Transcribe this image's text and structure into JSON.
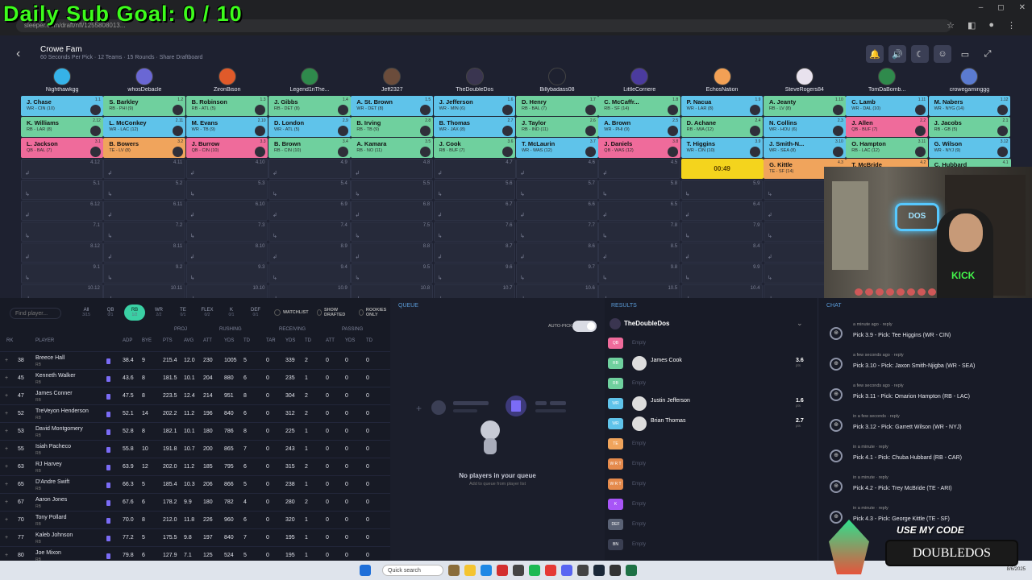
{
  "overlay": {
    "goal_label": "Daily Sub Goal:",
    "goal_value": "0 / 10"
  },
  "browser": {
    "url": "sleeper.com/draft/nfl/1255808013...",
    "win_min": "–",
    "win_max": "◻",
    "win_close": "✕"
  },
  "draft": {
    "title": "Crowe Fam",
    "subtitle": "60 Seconds Per Pick · 12 Teams · 15 Rounds · Share Draftboard",
    "timer": "00:49",
    "colors": {
      "WR": "#5fc3ea",
      "RB": "#6fd09e",
      "QB": "#ef6b9b",
      "TE": "#f0a45c",
      "timer": "#f4d41d"
    }
  },
  "teams": [
    {
      "name": "Nighthawkgg",
      "color": "#36b2e8"
    },
    {
      "name": "whosDebacle",
      "color": "#6a67d4"
    },
    {
      "name": "ZironBison",
      "color": "#e05a2a"
    },
    {
      "name": "Legend1nThe...",
      "color": "#2f8a4c"
    },
    {
      "name": "Jeff2327",
      "color": "#6b4c3b"
    },
    {
      "name": "TheDoubleDos",
      "color": "#3a3550"
    },
    {
      "name": "Billybadass08",
      "color": "#1e2130"
    },
    {
      "name": "LittleCorriere",
      "color": "#4b3b9e"
    },
    {
      "name": "EchosNation",
      "color": "#f2a055"
    },
    {
      "name": "SteveRogers84",
      "color": "#e8e2ee"
    },
    {
      "name": "TomDaBomb...",
      "color": "#2f8a4c"
    },
    {
      "name": "crowegaminggg",
      "color": "#5b7bd0"
    }
  ],
  "board": {
    "round1": [
      {
        "name": "J. Chase",
        "detail": "WR - CIN (10)",
        "pick": "1.1",
        "pos": "WR"
      },
      {
        "name": "S. Barkley",
        "detail": "RB - PHI (9)",
        "pick": "1.2",
        "pos": "RB"
      },
      {
        "name": "B. Robinson",
        "detail": "RB - ATL (5)",
        "pick": "1.3",
        "pos": "RB"
      },
      {
        "name": "J. Gibbs",
        "detail": "RB - DET (8)",
        "pick": "1.4",
        "pos": "RB"
      },
      {
        "name": "A. St. Brown",
        "detail": "WR - DET (8)",
        "pick": "1.5",
        "pos": "WR"
      },
      {
        "name": "J. Jefferson",
        "detail": "WR - MIN (6)",
        "pick": "1.6",
        "pos": "WR"
      },
      {
        "name": "D. Henry",
        "detail": "RB - BAL (7)",
        "pick": "1.7",
        "pos": "RB"
      },
      {
        "name": "C. McCaffr...",
        "detail": "RB - SF (14)",
        "pick": "1.8",
        "pos": "RB"
      },
      {
        "name": "P. Nacua",
        "detail": "WR - LAR (8)",
        "pick": "1.9",
        "pos": "WR"
      },
      {
        "name": "A. Jeanty",
        "detail": "RB - LV (8)",
        "pick": "1.10",
        "pos": "RB"
      },
      {
        "name": "C. Lamb",
        "detail": "WR - DAL (10)",
        "pick": "1.11",
        "pos": "WR"
      },
      {
        "name": "M. Nabers",
        "detail": "WR - NYG (14)",
        "pick": "1.12",
        "pos": "WR"
      }
    ],
    "round2": [
      {
        "name": "K. Williams",
        "detail": "RB - LAR (8)",
        "pick": "2.12",
        "pos": "RB"
      },
      {
        "name": "L. McConkey",
        "detail": "WR - LAC (12)",
        "pick": "2.11",
        "pos": "WR"
      },
      {
        "name": "M. Evans",
        "detail": "WR - TB (9)",
        "pick": "2.10",
        "pos": "WR"
      },
      {
        "name": "D. London",
        "detail": "WR - ATL (5)",
        "pick": "2.9",
        "pos": "WR"
      },
      {
        "name": "B. Irving",
        "detail": "RB - TB (9)",
        "pick": "2.8",
        "pos": "RB"
      },
      {
        "name": "B. Thomas",
        "detail": "WR - JAX (8)",
        "pick": "2.7",
        "pos": "WR"
      },
      {
        "name": "J. Taylor",
        "detail": "RB - IND (11)",
        "pick": "2.6",
        "pos": "RB"
      },
      {
        "name": "A. Brown",
        "detail": "WR - PHI (9)",
        "pick": "2.5",
        "pos": "WR"
      },
      {
        "name": "D. Achane",
        "detail": "RB - MIA (12)",
        "pick": "2.4",
        "pos": "RB"
      },
      {
        "name": "N. Collins",
        "detail": "WR - HOU (6)",
        "pick": "2.3",
        "pos": "WR"
      },
      {
        "name": "J. Allen",
        "detail": "QB - BUF (7)",
        "pick": "2.2",
        "pos": "QB"
      },
      {
        "name": "J. Jacobs",
        "detail": "RB - GB (5)",
        "pick": "2.1",
        "pos": "RB"
      }
    ],
    "round3": [
      {
        "name": "L. Jackson",
        "detail": "QB - BAL (7)",
        "pick": "3.1",
        "pos": "QB"
      },
      {
        "name": "B. Bowers",
        "detail": "TE - LV (8)",
        "pick": "3.2",
        "pos": "TE"
      },
      {
        "name": "J. Burrow",
        "detail": "QB - CIN (10)",
        "pick": "3.3",
        "pos": "QB"
      },
      {
        "name": "B. Brown",
        "detail": "RB - CIN (10)",
        "pick": "3.4",
        "pos": "RB"
      },
      {
        "name": "A. Kamara",
        "detail": "RB - NO (11)",
        "pick": "3.5",
        "pos": "RB"
      },
      {
        "name": "J. Cook",
        "detail": "RB - BUF (7)",
        "pick": "3.6",
        "pos": "RB"
      },
      {
        "name": "T. McLaurin",
        "detail": "WR - WAS (12)",
        "pick": "3.7",
        "pos": "WR"
      },
      {
        "name": "J. Daniels",
        "detail": "QB - WAS (12)",
        "pick": "3.8",
        "pos": "QB"
      },
      {
        "name": "T. Higgins",
        "detail": "WR - CIN (10)",
        "pick": "3.9",
        "pos": "WR"
      },
      {
        "name": "J. Smith-N...",
        "detail": "WR - SEA (8)",
        "pick": "3.10",
        "pos": "WR"
      },
      {
        "name": "O. Hampton",
        "detail": "RB - LAC (12)",
        "pick": "3.11",
        "pos": "RB"
      },
      {
        "name": "G. Wilson",
        "detail": "WR - NYJ (9)",
        "pick": "3.12",
        "pos": "WR"
      }
    ],
    "round4": [
      {
        "pick": "4.12"
      },
      {
        "pick": "4.11"
      },
      {
        "pick": "4.10"
      },
      {
        "pick": "4.9"
      },
      {
        "pick": "4.8"
      },
      {
        "pick": "4.7"
      },
      {
        "pick": "4.6"
      },
      {
        "pick": "4.5"
      },
      {
        "timer": "00:49"
      },
      {
        "name": "G. Kittle",
        "detail": "TE - SF (14)",
        "pick": "4.3",
        "pos": "TE"
      },
      {
        "name": "T. McBride",
        "detail": "TE - ARI (8)",
        "pick": "4.2",
        "pos": "TE"
      },
      {
        "name": "C. Hubbard",
        "detail": "RB - CAR (14)",
        "pick": "4.1",
        "pos": "RB"
      }
    ],
    "empty_rows": [
      [
        "5.1",
        "5.2",
        "5.3",
        "5.4",
        "5.5",
        "5.6",
        "5.7",
        "5.8",
        "5.9",
        "5.10",
        "5.11",
        "5.12"
      ],
      [
        "6.12",
        "6.11",
        "6.10",
        "6.9",
        "6.8",
        "6.7",
        "6.6",
        "6.5",
        "6.4",
        "6.3",
        "6.2",
        "6.1"
      ],
      [
        "7.1",
        "7.2",
        "7.3",
        "7.4",
        "7.5",
        "7.6",
        "7.7",
        "7.8",
        "7.9",
        "7.10",
        "7.11",
        "7.12"
      ],
      [
        "8.12",
        "8.11",
        "8.10",
        "8.9",
        "8.8",
        "8.7",
        "8.6",
        "8.5",
        "8.4",
        "8.3",
        "8.2",
        "8.1"
      ],
      [
        "9.1",
        "9.2",
        "9.3",
        "9.4",
        "9.5",
        "9.6",
        "9.7",
        "9.8",
        "9.9",
        "9.10",
        "9.11",
        "9.12"
      ],
      [
        "10.12",
        "10.11",
        "10.10",
        "10.9",
        "10.8",
        "10.7",
        "10.6",
        "10.5",
        "10.4",
        "10.3",
        "10.2",
        "10.1"
      ]
    ]
  },
  "webcam": {
    "neon_text": "DOS",
    "shirt_text": "KICK"
  },
  "player_list": {
    "search_placeholder": "Find player...",
    "positions": [
      {
        "label": "All",
        "count": "3/15"
      },
      {
        "label": "QB",
        "count": "0/1"
      },
      {
        "label": "RB",
        "count": "1/2"
      },
      {
        "label": "WR",
        "count": "2/2"
      },
      {
        "label": "TE",
        "count": "0/1"
      },
      {
        "label": "FLEX",
        "count": "0/2"
      },
      {
        "label": "K",
        "count": "0/1"
      },
      {
        "label": "DEF",
        "count": "0/1"
      }
    ],
    "toggles": [
      "WATCHLIST",
      "SHOW DRAFTED",
      "ROOKIES ONLY"
    ],
    "groups": {
      "proj": "PROJ",
      "rushing": "RUSHING",
      "receiving": "RECEIVING",
      "passing": "PASSING"
    },
    "columns": [
      "RK",
      "PLAYER",
      "ADP",
      "BYE",
      "PTS",
      "AVG",
      "ATT",
      "YDS",
      "TD",
      "TAR",
      "YDS",
      "TD",
      "ATT",
      "YDS",
      "TD"
    ],
    "rows": [
      {
        "rk": "38",
        "name": "Breece Hall",
        "team": "RB",
        "adp": "38.4",
        "bye": "9",
        "pts": "215.4",
        "avg": "12.0",
        "ratt": "230",
        "ryds": "1005",
        "rtd": "5",
        "tar": "0",
        "recyds": "339",
        "rectd": "2",
        "patt": "0",
        "pyds": "0",
        "ptd": "0"
      },
      {
        "rk": "45",
        "name": "Kenneth Walker",
        "team": "RB",
        "adp": "43.6",
        "bye": "8",
        "pts": "181.5",
        "avg": "10.1",
        "ratt": "204",
        "ryds": "880",
        "rtd": "6",
        "tar": "0",
        "recyds": "235",
        "rectd": "1",
        "patt": "0",
        "pyds": "0",
        "ptd": "0"
      },
      {
        "rk": "47",
        "name": "James Conner",
        "team": "RB",
        "adp": "47.5",
        "bye": "8",
        "pts": "223.5",
        "avg": "12.4",
        "ratt": "214",
        "ryds": "951",
        "rtd": "8",
        "tar": "0",
        "recyds": "304",
        "rectd": "2",
        "patt": "0",
        "pyds": "0",
        "ptd": "0"
      },
      {
        "rk": "52",
        "name": "TreVeyon Henderson",
        "team": "RB",
        "adp": "52.1",
        "bye": "14",
        "pts": "202.2",
        "avg": "11.2",
        "ratt": "196",
        "ryds": "840",
        "rtd": "6",
        "tar": "0",
        "recyds": "312",
        "rectd": "2",
        "patt": "0",
        "pyds": "0",
        "ptd": "0"
      },
      {
        "rk": "53",
        "name": "David Montgomery",
        "team": "RB",
        "adp": "52.8",
        "bye": "8",
        "pts": "182.1",
        "avg": "10.1",
        "ratt": "180",
        "ryds": "786",
        "rtd": "8",
        "tar": "0",
        "recyds": "225",
        "rectd": "1",
        "patt": "0",
        "pyds": "0",
        "ptd": "0"
      },
      {
        "rk": "55",
        "name": "Isiah Pacheco",
        "team": "RB",
        "adp": "55.8",
        "bye": "10",
        "pts": "191.8",
        "avg": "10.7",
        "ratt": "200",
        "ryds": "865",
        "rtd": "7",
        "tar": "0",
        "recyds": "243",
        "rectd": "1",
        "patt": "0",
        "pyds": "0",
        "ptd": "0"
      },
      {
        "rk": "63",
        "name": "RJ Harvey",
        "team": "RB",
        "adp": "63.9",
        "bye": "12",
        "pts": "202.0",
        "avg": "11.2",
        "ratt": "185",
        "ryds": "795",
        "rtd": "6",
        "tar": "0",
        "recyds": "315",
        "rectd": "2",
        "patt": "0",
        "pyds": "0",
        "ptd": "0"
      },
      {
        "rk": "65",
        "name": "D'Andre Swift",
        "team": "RB",
        "adp": "66.3",
        "bye": "5",
        "pts": "185.4",
        "avg": "10.3",
        "ratt": "206",
        "ryds": "866",
        "rtd": "5",
        "tar": "0",
        "recyds": "238",
        "rectd": "1",
        "patt": "0",
        "pyds": "0",
        "ptd": "0"
      },
      {
        "rk": "67",
        "name": "Aaron Jones",
        "team": "RB",
        "adp": "67.6",
        "bye": "6",
        "pts": "178.2",
        "avg": "9.9",
        "ratt": "180",
        "ryds": "782",
        "rtd": "4",
        "tar": "0",
        "recyds": "280",
        "rectd": "2",
        "patt": "0",
        "pyds": "0",
        "ptd": "0"
      },
      {
        "rk": "70",
        "name": "Tony Pollard",
        "team": "RB",
        "adp": "70.0",
        "bye": "8",
        "pts": "212.0",
        "avg": "11.8",
        "ratt": "226",
        "ryds": "960",
        "rtd": "6",
        "tar": "0",
        "recyds": "320",
        "rectd": "1",
        "patt": "0",
        "pyds": "0",
        "ptd": "0"
      },
      {
        "rk": "77",
        "name": "Kaleb Johnson",
        "team": "RB",
        "adp": "77.2",
        "bye": "5",
        "pts": "175.5",
        "avg": "9.8",
        "ratt": "197",
        "ryds": "840",
        "rtd": "7",
        "tar": "0",
        "recyds": "195",
        "rectd": "1",
        "patt": "0",
        "pyds": "0",
        "ptd": "0"
      },
      {
        "rk": "80",
        "name": "Joe Mixon",
        "team": "RB",
        "adp": "79.8",
        "bye": "6",
        "pts": "127.9",
        "avg": "7.1",
        "ratt": "125",
        "ryds": "524",
        "rtd": "5",
        "tar": "0",
        "recyds": "195",
        "rectd": "1",
        "patt": "0",
        "pyds": "0",
        "ptd": "0"
      }
    ]
  },
  "queue": {
    "label": "QUEUE",
    "autopick": "AUTO-PICK",
    "empty_title": "No players in your queue",
    "empty_sub": "Add to queue from player list"
  },
  "results": {
    "label": "RESULTS",
    "team": "TheDoubleDos",
    "rows": [
      {
        "pos": "QB",
        "color": "#ef6b9b",
        "empty": "Empty"
      },
      {
        "pos": "RB",
        "color": "#6fd09e",
        "name": "James Cook",
        "pts": "3.6",
        "ptslbl": "pts"
      },
      {
        "pos": "RB",
        "color": "#6fd09e",
        "empty": "Empty"
      },
      {
        "pos": "WR",
        "color": "#5fc3ea",
        "name": "Justin Jefferson",
        "pts": "1.6",
        "ptslbl": "pts"
      },
      {
        "pos": "WR",
        "color": "#5fc3ea",
        "name": "Brian Thomas",
        "pts": "2.7",
        "ptslbl": "pts"
      },
      {
        "pos": "TE",
        "color": "#f0a45c",
        "empty": "Empty"
      },
      {
        "pos": "W R T",
        "color": "#e58a4c",
        "empty": "Empty"
      },
      {
        "pos": "W R T",
        "color": "#e58a4c",
        "empty": "Empty"
      },
      {
        "pos": "K",
        "color": "#a855f7",
        "empty": "Empty"
      },
      {
        "pos": "DEF",
        "color": "#5a6275",
        "empty": "Empty"
      },
      {
        "pos": "BN",
        "color": "#3a3f52",
        "empty": "Empty"
      }
    ]
  },
  "chat": {
    "label": "CHAT",
    "messages": [
      {
        "time": "a minute ago · reply",
        "text": "Pick 3.9 - Pick: Tee Higgins (WR - CIN)"
      },
      {
        "time": "a few seconds ago · reply",
        "text": "Pick 3.10 - Pick: Jaxon Smith-Njigba (WR - SEA)"
      },
      {
        "time": "a few seconds ago · reply",
        "text": "Pick 3.11 - Pick: Omarion Hampton (RB - LAC)"
      },
      {
        "time": "in a few seconds · reply",
        "text": "Pick 3.12 - Pick: Garrett Wilson (WR - NYJ)"
      },
      {
        "time": "in a minute · reply",
        "text": "Pick 4.1 - Pick: Chuba Hubbard (RB - CAR)"
      },
      {
        "time": "in a minute · reply",
        "text": "Pick 4.2 - Pick: Trey McBride (TE - ARI)"
      },
      {
        "time": "in a minute · reply",
        "text": "Pick 4.3 - Pick: George Kittle (TE - SF)"
      }
    ]
  },
  "promo": {
    "label": "USE MY CODE",
    "code": "DOUBLEDOS"
  },
  "taskbar": {
    "search": "Quick search",
    "clock": "8/6/2025"
  }
}
